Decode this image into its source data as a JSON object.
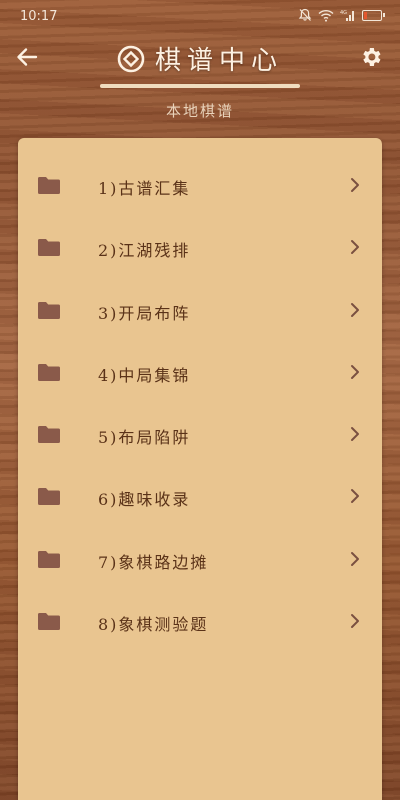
{
  "status_bar": {
    "time": "10:17",
    "network_label": "4G",
    "battery_level": 0.2,
    "icons": [
      "do-not-disturb-icon",
      "wifi-icon",
      "signal-icon",
      "battery-icon"
    ]
  },
  "header": {
    "title": "棋谱中心",
    "subtitle": "本地棋谱",
    "icons": [
      "back-arrow-icon",
      "logo-icon",
      "settings-gear-icon"
    ]
  },
  "colors": {
    "panel_background": "#e9c590",
    "item_text": "#5a3218",
    "folder_icon": "#8a5a4a",
    "title_text": "#fdf1e2"
  },
  "folders": [
    {
      "label": "1)古谱汇集"
    },
    {
      "label": "2)江湖残排"
    },
    {
      "label": "3)开局布阵"
    },
    {
      "label": "4)中局集锦"
    },
    {
      "label": "5)布局陷阱"
    },
    {
      "label": "6)趣味收录"
    },
    {
      "label": "7)象棋路边摊"
    },
    {
      "label": "8)象棋测验题"
    }
  ]
}
